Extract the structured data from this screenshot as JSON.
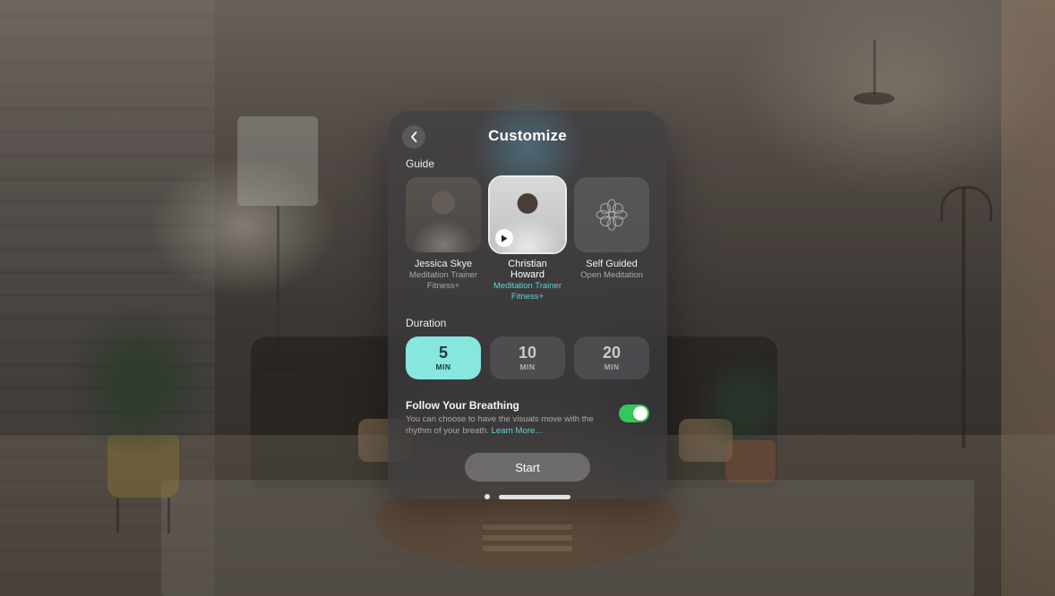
{
  "header": {
    "title": "Customize"
  },
  "sections": {
    "guide_label": "Guide",
    "duration_label": "Duration"
  },
  "guides": [
    {
      "name": "Jessica Skye",
      "subtitle_line1": "Meditation Trainer",
      "subtitle_line2": "Fitness+",
      "selected": false,
      "has_play": false,
      "icon": "person"
    },
    {
      "name": "Christian Howard",
      "subtitle_line1": "Meditation Trainer",
      "subtitle_line2": "Fitness+",
      "selected": true,
      "has_play": true,
      "icon": "person"
    },
    {
      "name": "Self Guided",
      "subtitle_line1": "Open Meditation",
      "subtitle_line2": "",
      "selected": false,
      "has_play": false,
      "icon": "flower"
    }
  ],
  "durations": [
    {
      "value": "5",
      "unit": "MIN",
      "selected": true
    },
    {
      "value": "10",
      "unit": "MIN",
      "selected": false
    },
    {
      "value": "20",
      "unit": "MIN",
      "selected": false
    }
  ],
  "breathing": {
    "title": "Follow Your Breathing",
    "description": "You can choose to have the visuals move with the rhythm of your breath. ",
    "learn_more": "Learn More…",
    "enabled": true
  },
  "start_label": "Start",
  "colors": {
    "accent_teal": "#87e6de",
    "link_teal": "#5fd6d0",
    "toggle_green": "#34c759"
  }
}
